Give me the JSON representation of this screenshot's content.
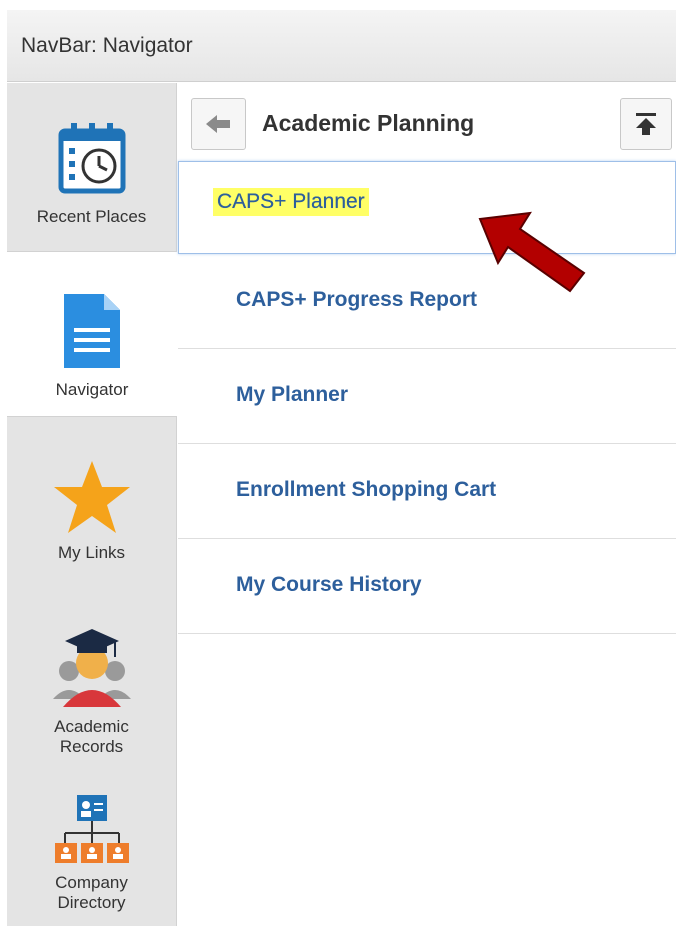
{
  "titlebar": {
    "title": "NavBar: Navigator"
  },
  "sidebar": {
    "items": [
      {
        "label": "Recent Places",
        "icon": "calendar-clock-icon"
      },
      {
        "label": "Navigator",
        "icon": "document-icon",
        "active": true
      },
      {
        "label": "My Links",
        "icon": "star-icon"
      },
      {
        "label": "Academic\nRecords",
        "line1": "Academic",
        "line2": "Records",
        "icon": "graduate-icon"
      },
      {
        "label": "Company\nDirectory",
        "line1": "Company",
        "line2": "Directory",
        "icon": "org-chart-icon"
      }
    ]
  },
  "header": {
    "title": "Academic Planning",
    "back_icon": "back-arrow-icon",
    "top_icon": "scroll-top-icon"
  },
  "nav": {
    "items": [
      {
        "label": "CAPS+ Planner",
        "selected": true
      },
      {
        "label": "CAPS+ Progress Report"
      },
      {
        "label": "My Planner"
      },
      {
        "label": "Enrollment Shopping Cart"
      },
      {
        "label": "My Course History"
      }
    ]
  },
  "annotation": {
    "arrow_color": "#b30000",
    "highlight_color": "#ffff66"
  }
}
